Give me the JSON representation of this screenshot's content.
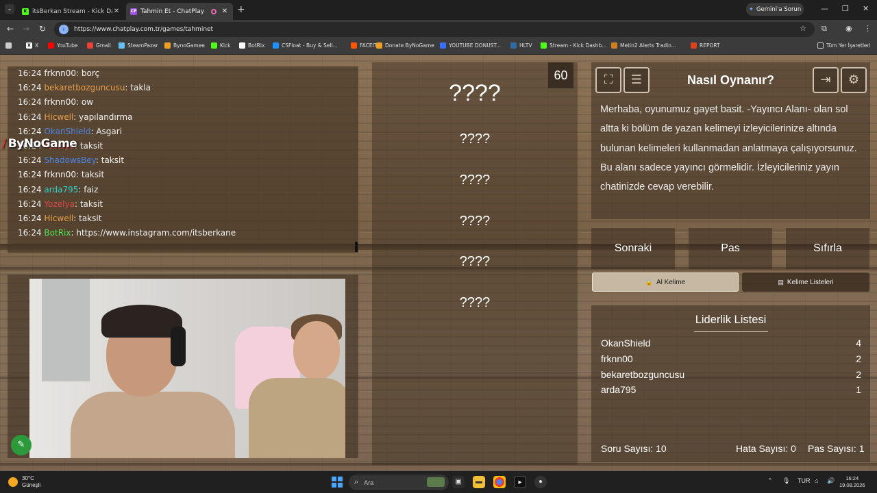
{
  "browser": {
    "tabs": [
      {
        "title": "itsBerkan Stream - Kick Dashbo",
        "favicon": "kick-icon",
        "color": "#53fc18"
      },
      {
        "title": "Tahmin Et - ChatPlay",
        "favicon": "chatplay-icon",
        "color": "#9c4fe0",
        "fav_text": "CP"
      }
    ],
    "gemini_label": "Gemini'a Sorun",
    "url": "https://www.chatplay.com.tr/games/tahminet",
    "bookmarks": [
      {
        "label": "X",
        "color": "#ffffff",
        "text": "X"
      },
      {
        "label": "YouTube",
        "color": "#ff0000"
      },
      {
        "label": "Gmail",
        "color": "#ea4335"
      },
      {
        "label": "SteamPazar",
        "color": "#66c0f4"
      },
      {
        "label": "BynoGamee",
        "color": "#f0a020"
      },
      {
        "label": "Kick",
        "color": "#53fc18"
      },
      {
        "label": "BotRix",
        "color": "#ffffff"
      },
      {
        "label": "CSFloat - Buy & Sell...",
        "color": "#1e90ff"
      },
      {
        "label": "FACEIT",
        "color": "#ff5500"
      },
      {
        "label": "Donate ByNoGame",
        "color": "#f0a020"
      },
      {
        "label": "YOUTUBE DONUST...",
        "color": "#3b6dff"
      },
      {
        "label": "HLTV",
        "color": "#2d6da3"
      },
      {
        "label": "Stream - Kick Dashb...",
        "color": "#53fc18"
      },
      {
        "label": "Metin2 Alerts Tradin...",
        "color": "#d08020"
      },
      {
        "label": "REPORT",
        "color": "#e04020"
      }
    ],
    "all_bookmarks": "Tüm Yer İşaretleri"
  },
  "chat": {
    "messages": [
      {
        "time": "16:24",
        "user": "frknn00",
        "text": ": borç",
        "color": "white"
      },
      {
        "time": "16:24",
        "user": "bekaretbozguncusu",
        "text": ": takla",
        "color": "orange"
      },
      {
        "time": "16:24",
        "user": "frknn00",
        "text": ": ow",
        "color": "white"
      },
      {
        "time": "16:24",
        "user": "Hicwell",
        "text": ": yapılandırma",
        "color": "orange"
      },
      {
        "time": "16:24",
        "user": "OkanShield",
        "text": ": Asgari",
        "color": "blue"
      },
      {
        "time": "16:24",
        "user": "Yozelya",
        "text": ": taksit",
        "color": "red"
      },
      {
        "time": "16:24",
        "user": "ShadowsBey",
        "text": ": taksit",
        "color": "blue"
      },
      {
        "time": "16:24",
        "user": "frknn00",
        "text": ": taksit",
        "color": "white"
      },
      {
        "time": "16:24",
        "user": "arda795",
        "text": ": faiz",
        "color": "teal"
      },
      {
        "time": "16:24",
        "user": "Yozelya",
        "text": ": taksit",
        "color": "red"
      },
      {
        "time": "16:24",
        "user": "Hicwell",
        "text": ": taksit",
        "color": "orange"
      },
      {
        "time": "16:24",
        "user": "BotRix",
        "text": ": https://www.instagram.com/itsberkane",
        "color": "green"
      }
    ],
    "overlay_logo": "ByNoGame"
  },
  "game": {
    "timer": "60",
    "main_word": "????",
    "taboo_words": [
      "????",
      "????",
      "????",
      "????",
      "????"
    ]
  },
  "howto": {
    "title": "Nasıl Oynanır?",
    "description": "Merhaba, oyunumuz gayet basit. -Yayıncı Alanı- olan sol altta ki bölüm de yazan kelimeyi izleyicilerinize altında bulunan kelimeleri kullanmadan anlatmaya çalışıyorsunuz. Bu alanı sadece yayıncı görmelidir. İzleyicileriniz yayın chatinizde cevap verebilir."
  },
  "controls": {
    "next": "Sonraki",
    "pass": "Pas",
    "reset": "Sıfırla",
    "get_word": "Al Kelime",
    "word_lists": "Kelime Listeleri"
  },
  "leaderboard": {
    "title": "Liderlik Listesi",
    "rows": [
      {
        "name": "OkanShield",
        "score": "4"
      },
      {
        "name": "frknn00",
        "score": "2"
      },
      {
        "name": "bekaretbozguncusu",
        "score": "2"
      },
      {
        "name": "arda795",
        "score": "1"
      }
    ],
    "question_count": "Soru Sayısı: 10",
    "error_count": "Hata Sayısı: 0",
    "pass_count": "Pas Sayısı: 1"
  },
  "taskbar": {
    "temp": "30°C",
    "weather": "Güneşli",
    "search_placeholder": "Ara",
    "lang": "TUR",
    "time": "16:24",
    "date": "19.08.2026"
  }
}
